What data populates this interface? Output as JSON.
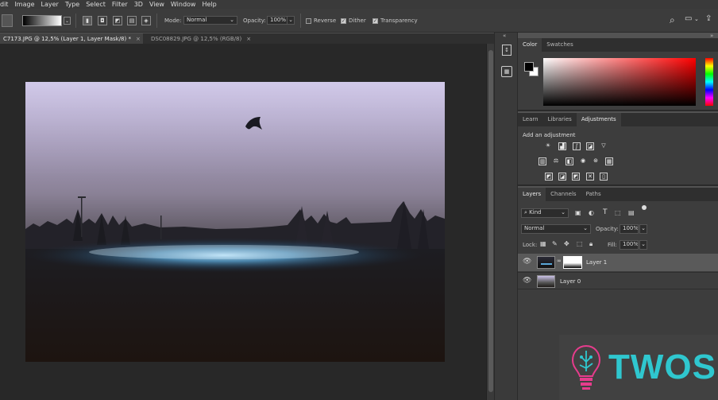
{
  "menu": [
    "dit",
    "Image",
    "Layer",
    "Type",
    "Select",
    "Filter",
    "3D",
    "View",
    "Window",
    "Help"
  ],
  "options": {
    "mode_label": "Mode:",
    "mode_value": "Normal",
    "opacity_label": "Opacity:",
    "opacity_value": "100%",
    "reverse_label": "Reverse",
    "dither_label": "Dither",
    "transparency_label": "Transparency",
    "reverse_checked": false,
    "dither_checked": true,
    "transparency_checked": true
  },
  "tabs": [
    {
      "label": "C7173.JPG @ 12,5% (Layer 1, Layer Mask/8) *",
      "close": "×"
    },
    {
      "label": "DSC08829.JPG @ 12,5% (RGB/8)",
      "close": "×"
    }
  ],
  "color_panel": {
    "tabs": [
      "Color",
      "Swatches"
    ],
    "accent_hue": "#ff0000"
  },
  "adjust_panel": {
    "tabs": [
      "Learn",
      "Libraries",
      "Adjustments"
    ],
    "heading": "Add an adjustment"
  },
  "layers_panel": {
    "tabs": [
      "Layers",
      "Channels",
      "Paths"
    ],
    "kind_label": "Kind",
    "blend_mode": "Normal",
    "opacity_label": "Opacity:",
    "opacity_value": "100%",
    "lock_label": "Lock:",
    "fill_label": "Fill:",
    "fill_value": "100%",
    "layers": [
      {
        "name": "Layer 1",
        "selected": true
      },
      {
        "name": "Layer 0",
        "selected": false
      }
    ]
  },
  "watermark": {
    "text": "TWOS"
  }
}
